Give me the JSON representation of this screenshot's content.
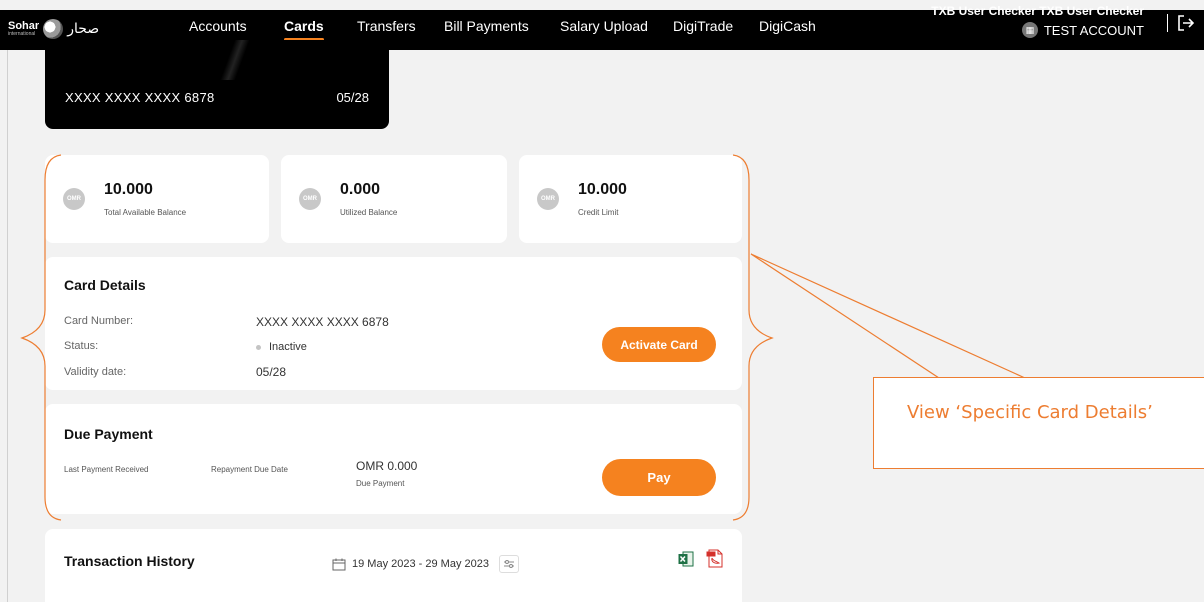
{
  "brand": {
    "logo_text": "Sohar",
    "logo_subtext": "international",
    "logo_arabic": "صحار"
  },
  "nav": {
    "items": [
      {
        "label": "Accounts",
        "active": false
      },
      {
        "label": "Cards",
        "active": true
      },
      {
        "label": "Transfers",
        "active": false
      },
      {
        "label": "Bill Payments",
        "active": false
      },
      {
        "label": "Salary Upload",
        "active": false
      },
      {
        "label": "DigiTrade",
        "active": false
      },
      {
        "label": "DigiCash",
        "active": false
      }
    ],
    "user_name": "TXB User Checker TXB User Checker",
    "account_name": "TEST ACCOUNT"
  },
  "card": {
    "number": "XXXX XXXX XXXX 6878",
    "expiry": "05/28"
  },
  "balances": [
    {
      "currency": "OMR",
      "amount": "10.000",
      "label": "Total Available Balance"
    },
    {
      "currency": "OMR",
      "amount": "0.000",
      "label": "Utilized Balance"
    },
    {
      "currency": "OMR",
      "amount": "10.000",
      "label": "Credit Limit"
    }
  ],
  "card_details": {
    "title": "Card Details",
    "number_label": "Card Number:",
    "number_value": "XXXX XXXX XXXX 6878",
    "status_label": "Status:",
    "status_value": "Inactive",
    "validity_label": "Validity date:",
    "validity_value": "05/28",
    "activate_button": "Activate Card"
  },
  "due_payment": {
    "title": "Due Payment",
    "last_payment_label": "Last Payment Received",
    "repayment_due_label": "Repayment Due Date",
    "amount": "OMR 0.000",
    "amount_label": "Due Payment",
    "pay_button": "Pay"
  },
  "transaction_history": {
    "title": "Transaction History",
    "date_range": "19 May 2023 - 29 May 2023"
  },
  "annotation": {
    "text": "View ‘Specific Card Details’",
    "color": "#ed7d31"
  },
  "colors": {
    "accent": "#f5821f",
    "nav_bg": "#000000",
    "page_bg": "#f2f2f2"
  }
}
